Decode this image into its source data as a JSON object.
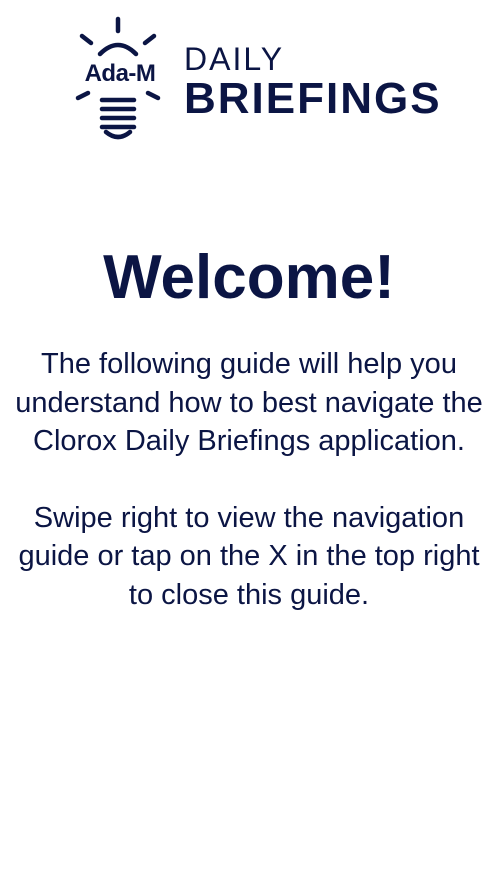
{
  "logo": {
    "bulb_label": "Ada-M",
    "line1": "DAILY",
    "line2": "BRIEFINGS",
    "icon": "lightbulb-icon"
  },
  "welcome": {
    "title": "Welcome!",
    "paragraph1": "The following guide will help you understand how to best navigate the Clorox Daily Briefings application.",
    "paragraph2": "Swipe right to view the navigation guide or tap on the X in the top right to close this guide."
  },
  "colors": {
    "text": "#0b1544",
    "background": "#ffffff"
  }
}
